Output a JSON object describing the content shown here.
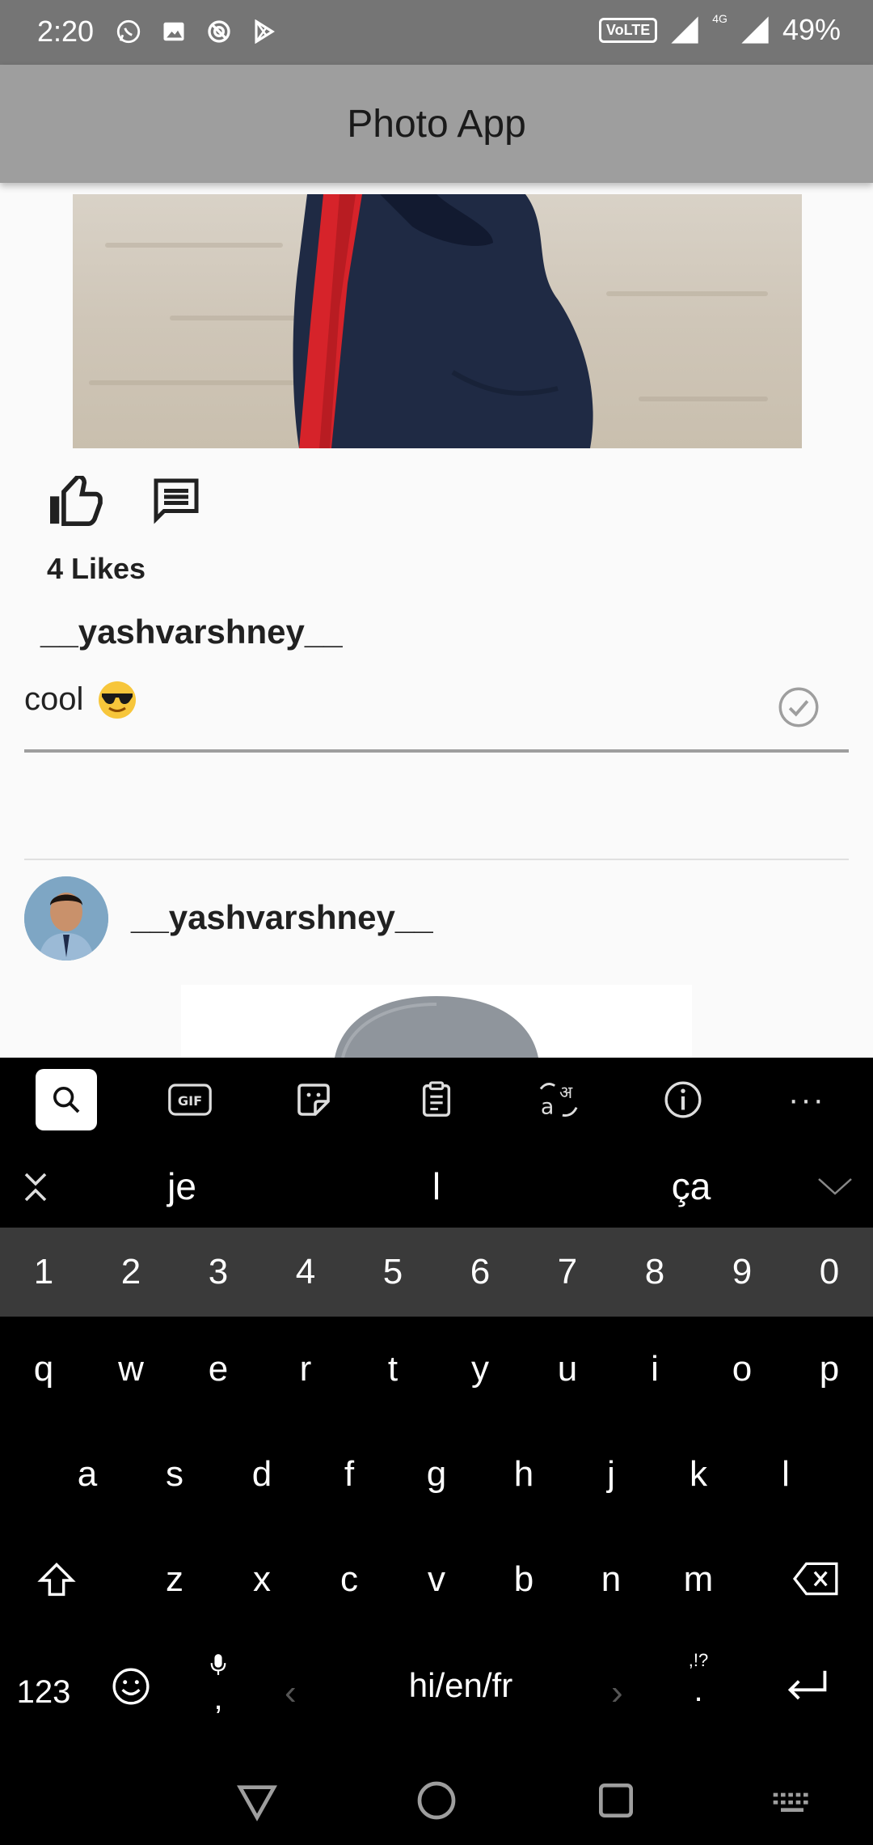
{
  "status_bar": {
    "time": "2:20",
    "volte": "VoLTE",
    "network": "4G",
    "battery": "49%"
  },
  "app_bar": {
    "title": "Photo App"
  },
  "post": {
    "likes": "4 Likes",
    "username": "__yashvarshney__",
    "comment_value": "cool",
    "comment_emoji": "smiling-face-with-sunglasses"
  },
  "next_post": {
    "username": "__yashvarshney__"
  },
  "keyboard": {
    "suggestions": [
      "je",
      "l",
      "ça"
    ],
    "numbers": [
      "1",
      "2",
      "3",
      "4",
      "5",
      "6",
      "7",
      "8",
      "9",
      "0"
    ],
    "row1": [
      "q",
      "w",
      "e",
      "r",
      "t",
      "y",
      "u",
      "i",
      "o",
      "p"
    ],
    "row2": [
      "a",
      "s",
      "d",
      "f",
      "g",
      "h",
      "j",
      "k",
      "l"
    ],
    "row3": [
      "z",
      "x",
      "c",
      "v",
      "b",
      "n",
      "m"
    ],
    "symbols_key": "123",
    "comma_key": ",",
    "space_label": "hi/en/fr",
    "period_key": ".",
    "punct_hint": ",!?"
  }
}
